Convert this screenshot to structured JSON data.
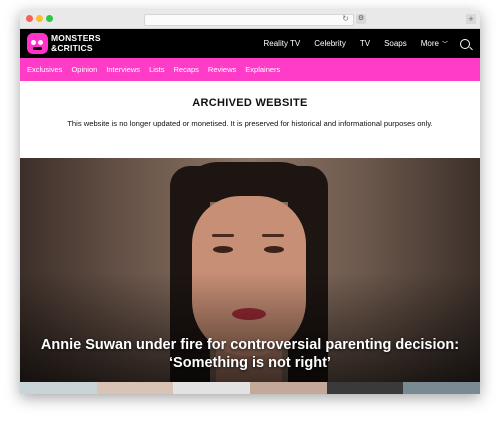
{
  "browser": {
    "reload_icon": "reload-icon",
    "shield_icon": "shield-icon",
    "new_tab_icon": "plus-icon"
  },
  "brand": {
    "line1": "MONSTERS",
    "line2": "&CRITICS",
    "accent": "#ff33cc"
  },
  "nav": {
    "items": [
      "Reality TV",
      "Celebrity",
      "TV",
      "Soaps"
    ],
    "more_label": "More",
    "search_icon": "search-icon"
  },
  "subnav": {
    "items": [
      "Exclusives",
      "Opinion",
      "Interviews",
      "Lists",
      "Recaps",
      "Reviews",
      "Explainers"
    ],
    "color": "#ff3cc8"
  },
  "notice": {
    "title": "ARCHIVED WEBSITE",
    "text": "This website is no longer updated or monetised. It is preserved for historical and informational purposes only."
  },
  "hero": {
    "headline_line1": "Annie Suwan under fire for controversial parenting decision:",
    "headline_line2": "‘Something is not right’"
  },
  "thumbnails": {
    "colors": [
      "#c8d4d8",
      "#d9c3b5",
      "#e2e2e2",
      "#c4a89a",
      "#3a3a3a",
      "#7a8a94"
    ]
  }
}
